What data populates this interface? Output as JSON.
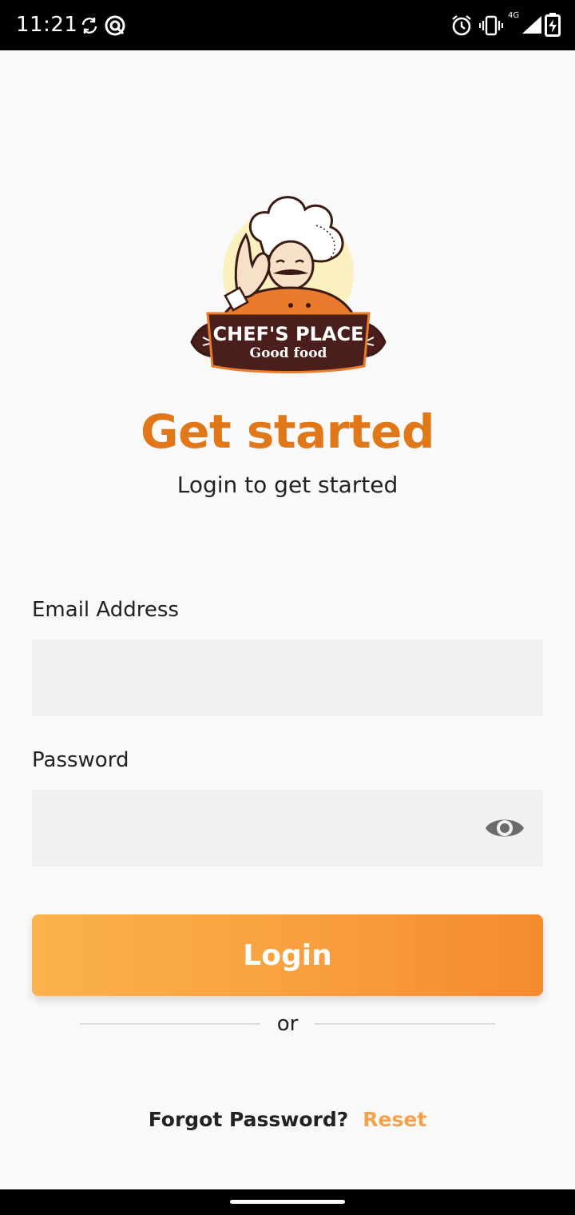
{
  "status_bar": {
    "time": "11:21",
    "network_label": "4G",
    "icons": [
      "sync-icon",
      "vpn-icon",
      "alarm-icon",
      "vibrate-icon",
      "signal-icon",
      "battery-charging-icon"
    ]
  },
  "logo": {
    "brand_name": "CHEF'S PLACE",
    "tagline": "Good food"
  },
  "header": {
    "title": "Get started",
    "subtitle": "Login to get started"
  },
  "form": {
    "email_label": "Email Address",
    "email_value": "",
    "password_label": "Password",
    "password_value": "",
    "password_toggle_icon": "eye-icon",
    "login_label": "Login"
  },
  "divider": {
    "text": "or"
  },
  "footer": {
    "forgot_text": "Forgot Password?",
    "reset_label": "Reset"
  },
  "colors": {
    "accent": "#e07718",
    "button_start": "#fbb24c",
    "button_end": "#f58a2e",
    "link": "#f4a14a",
    "field_bg": "#f1f1f1",
    "background": "#f9f9f9"
  }
}
